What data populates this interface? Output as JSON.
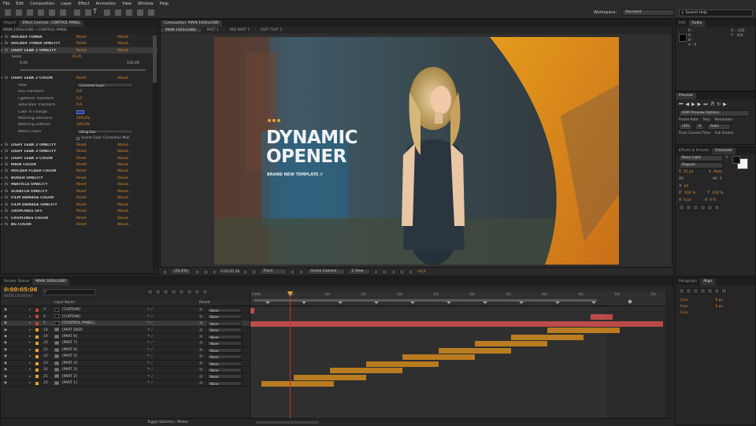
{
  "menu": [
    "File",
    "Edit",
    "Composition",
    "Layer",
    "Effect",
    "Animation",
    "View",
    "Window",
    "Help"
  ],
  "toolbar": {
    "workspace_label": "Workspace:",
    "workspace_value": "Standard",
    "search_placeholder": "Search Help"
  },
  "left_panel": {
    "tabs": [
      "Project",
      "Effect Controls: CONTROL PANEL"
    ],
    "path": "MAIN 1920x1080 • CONTROL PANEL",
    "reset": "Reset",
    "about": "About...",
    "effects_top": [
      "HOLDER TONER",
      "HOLDER TONER OPACITY",
      "LIGHT LEAK 1 OPACITY"
    ],
    "slider_label": "Slider",
    "slider_value": "35,45",
    "slider_min": "0,00",
    "slider_max": "100,00",
    "color_effect": "LIGHT LEAK 2 COLOR",
    "color_props": [
      {
        "name": "View",
        "value": "Corrected Layer"
      },
      {
        "name": "Hue Transform",
        "value": "0,0"
      },
      {
        "name": "Lightness Transform",
        "value": "0,0"
      },
      {
        "name": "Saturation Transform",
        "value": "0,0"
      },
      {
        "name": "Color To Change",
        "value": ""
      },
      {
        "name": "Matching Tolerance",
        "value": "100,0%"
      },
      {
        "name": "Matching Softness",
        "value": "100,0%"
      },
      {
        "name": "Match Colors",
        "value": "Using Hue"
      },
      {
        "name": "",
        "value": "Invert Color Correction Mas"
      }
    ],
    "effects_bottom": [
      "LIGHT LEAK 2 OPACITY",
      "LIGHT LEAK 3 OPACITY",
      "LIGHT LEAK 3 COLOR",
      "MAIN COLOR",
      "HOLDER FLASH COLOR",
      "BOKEH OPACITY",
      "PARTICLE OPACITY",
      "SCRATCH OPACITY",
      "FILM DAMAGE COLOR",
      "FILM DAMAGE OPACITY",
      "CROPLINES OFF",
      "CROPLINES COLOR",
      "BG COLOR"
    ]
  },
  "comp": {
    "tabs": [
      "Composition: MAIN 1920x1080"
    ],
    "subtabs": [
      "MAIN 1920x1080",
      "PART 1",
      "PRE PART 1",
      "EDIT TEXT 1"
    ],
    "title_line1": "DYNAMIC",
    "title_line2": "OPENER",
    "subtitle": "BRAND NEW TEMPLATE //",
    "footer": {
      "zoom": "(33,4%)",
      "timecode": "0:00:05:06",
      "res": "Third",
      "camera": "Active Camera",
      "view": "1 View",
      "exposure": "+0,0"
    }
  },
  "info": {
    "tabs": [
      "Info",
      "Audio"
    ],
    "r": "R :",
    "g": "G :",
    "b": "B :",
    "a": "A : 0",
    "x": "X : -242",
    "y": "Y : 314"
  },
  "preview": {
    "tab": "Preview",
    "options_label": "RAM Preview Options",
    "frame_rate_label": "Frame Rate",
    "skip_label": "Skip",
    "resolution_label": "Resolution",
    "frame_rate": "(30)",
    "skip": "0",
    "resolution": "Auto",
    "from_current": "From Current Time",
    "full_screen": "Full Screen"
  },
  "character": {
    "tabs": [
      "Effects & Presets",
      "Character"
    ],
    "font": "Nexa Light",
    "style": "Regular",
    "size": "15 px",
    "leading": "Auto",
    "tracking": "0",
    "unit": "px",
    "vscale": "100 %",
    "hscale": "100 %",
    "baseline": "0 px",
    "tsume": "0 %"
  },
  "paragraph": {
    "tabs": [
      "Paragraph",
      "Align"
    ],
    "vals": [
      "0 px",
      "0 px",
      "0 px",
      "0 px",
      "0 px"
    ]
  },
  "timeline": {
    "tabs": [
      "Render Queue",
      "MAIN 1920x1080"
    ],
    "timecode": "0:00:05:06",
    "frames": "00156 (30.00 fps)",
    "col_layer": "Layer Name",
    "col_parent": "Parent",
    "ticks": [
      "0:00s",
      "05s",
      "10s",
      "15s",
      "20s",
      "25s",
      "30s",
      "35s",
      "40s",
      "45s",
      "50s",
      "55s"
    ],
    "footer": "Toggle Switches / Modes",
    "layers": [
      {
        "num": "3",
        "name": "[CURTAIN]",
        "parent": "None"
      },
      {
        "num": "4",
        "name": "[CURTAIN]",
        "parent": "None"
      },
      {
        "num": "5",
        "name": "[CONTROL PANEL]",
        "parent": "None"
      },
      {
        "num": "18",
        "name": "[PART END]",
        "parent": "None"
      },
      {
        "num": "19",
        "name": "[PART 8]",
        "parent": "None"
      },
      {
        "num": "20",
        "name": "[PART 7]",
        "parent": "None"
      },
      {
        "num": "21",
        "name": "[PART 6]",
        "parent": "None"
      },
      {
        "num": "22",
        "name": "[PART 5]",
        "parent": "None"
      },
      {
        "num": "23",
        "name": "[PART 4]",
        "parent": "None"
      },
      {
        "num": "24",
        "name": "[PART 3]",
        "parent": "None"
      },
      {
        "num": "25",
        "name": "[PART 2]",
        "parent": "None"
      },
      {
        "num": "26",
        "name": "[PART 1]",
        "parent": "None"
      }
    ]
  },
  "colors": {
    "accent": "#e08a2e",
    "bar": "#b87a1c",
    "red_bar": "#b94a48",
    "current_time": "#c0392b"
  }
}
